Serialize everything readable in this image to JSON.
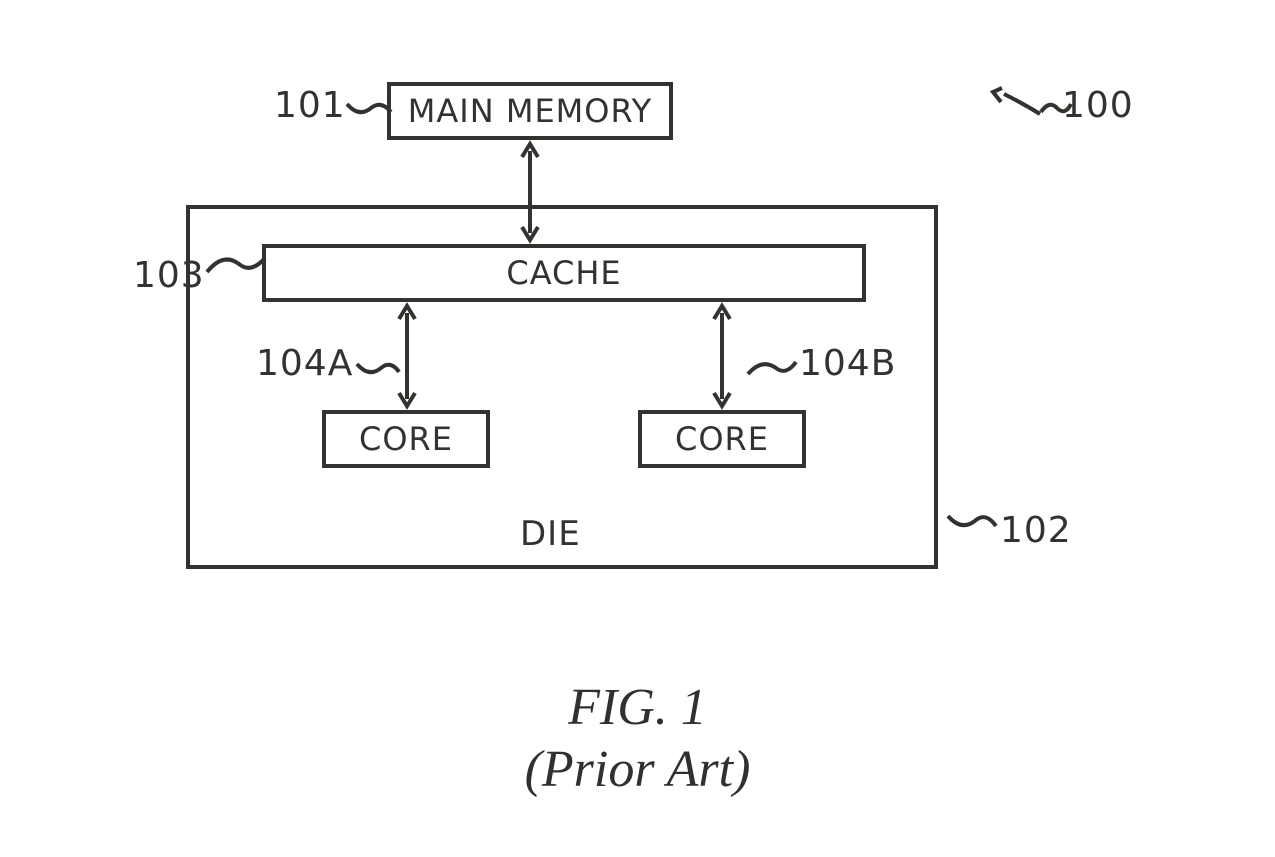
{
  "blocks": {
    "main_memory": "MAIN MEMORY",
    "cache": "CACHE",
    "core_a": "CORE",
    "core_b": "CORE",
    "die": "DIE"
  },
  "labels": {
    "ref_100": "100",
    "ref_101": "101",
    "ref_102": "102",
    "ref_103": "103",
    "ref_104a": "104A",
    "ref_104b": "104B"
  },
  "caption": {
    "line1": "FIG. 1",
    "line2": "(Prior Art)"
  }
}
